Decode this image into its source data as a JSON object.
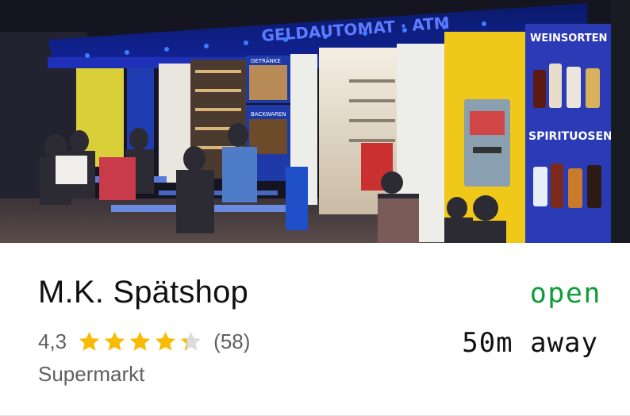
{
  "place": {
    "name": "M.K. Spätshop",
    "rating": "4,3",
    "rating_value": 4.3,
    "stars_max": 5,
    "review_count": "(58)",
    "category": "Supermarkt",
    "status": "open",
    "distance": "50m away"
  },
  "photo": {
    "awning_text": "GELDAUTOMAT · ATM",
    "sign_top": "WEINSORTEN",
    "sign_bottom": "SPIRITUOSEN",
    "window_label_1": "GETRÄNKE",
    "window_label_2": "BACKWAREN"
  },
  "colors": {
    "star": "#f9bc05",
    "star_empty": "#dadce0",
    "open": "#0f9d37",
    "muted": "#606060"
  }
}
